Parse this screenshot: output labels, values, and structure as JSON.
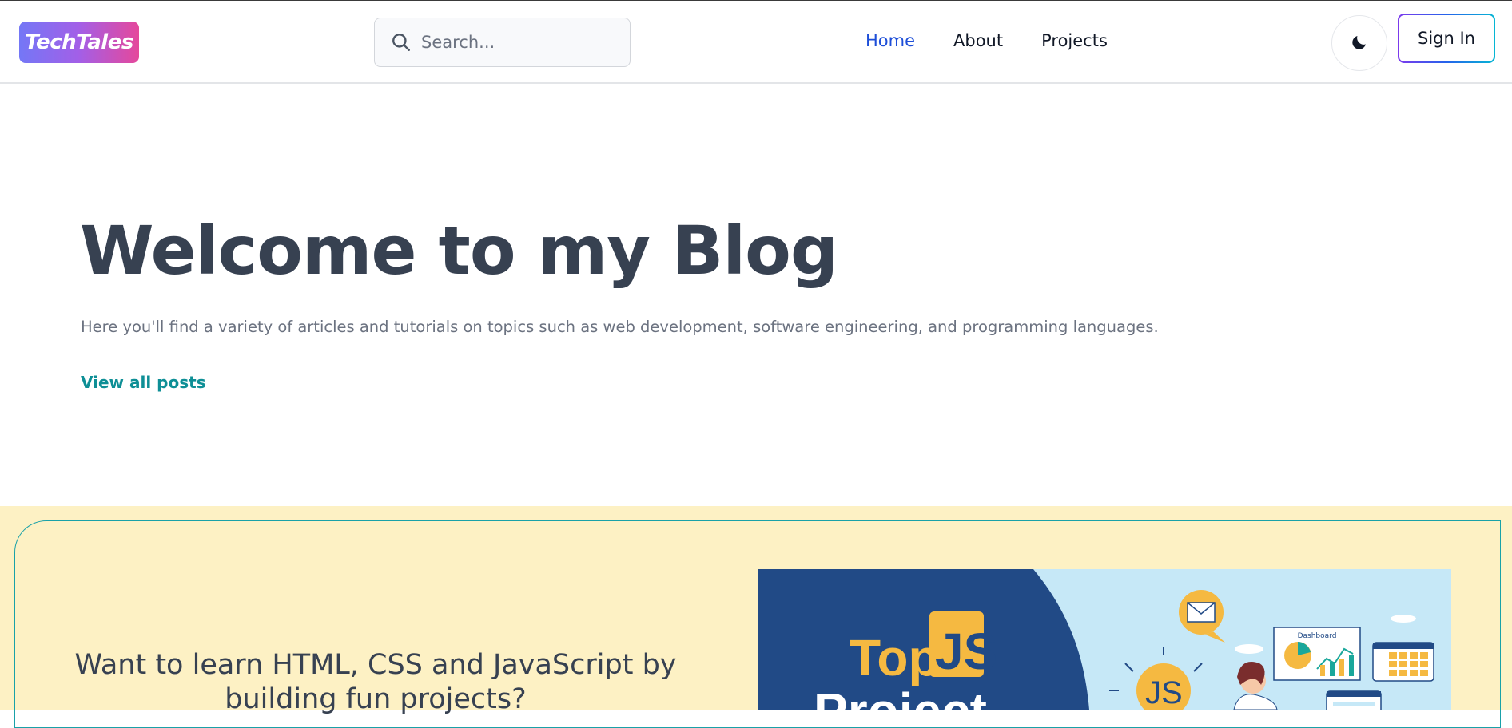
{
  "header": {
    "logo_text": "TechTales",
    "search_placeholder": "Search...",
    "nav": [
      {
        "label": "Home",
        "active": true
      },
      {
        "label": "About",
        "active": false
      },
      {
        "label": "Projects",
        "active": false
      }
    ],
    "theme_icon": "moon-icon",
    "signin_label": "Sign In"
  },
  "hero": {
    "title": "Welcome to my Blog",
    "subtitle": "Here you'll find a variety of articles and tutorials on topics such as web development, software engineering, and programming languages.",
    "link_label": "View all posts"
  },
  "promo": {
    "heading": "Want to learn HTML, CSS and JavaScript by building fun projects?",
    "image": {
      "title_top": "Top",
      "title_js": "JS",
      "title_main": "Project",
      "badge_js": "JS",
      "dashboard_label": "Dashboard"
    }
  },
  "colors": {
    "brand_gradient_start": "#7477f6",
    "brand_gradient_end": "#e5489b",
    "active_nav": "#1d4ed8",
    "link_teal": "#0e8f96",
    "promo_bg": "#fdf1c4",
    "promo_border": "#19a1a8"
  }
}
